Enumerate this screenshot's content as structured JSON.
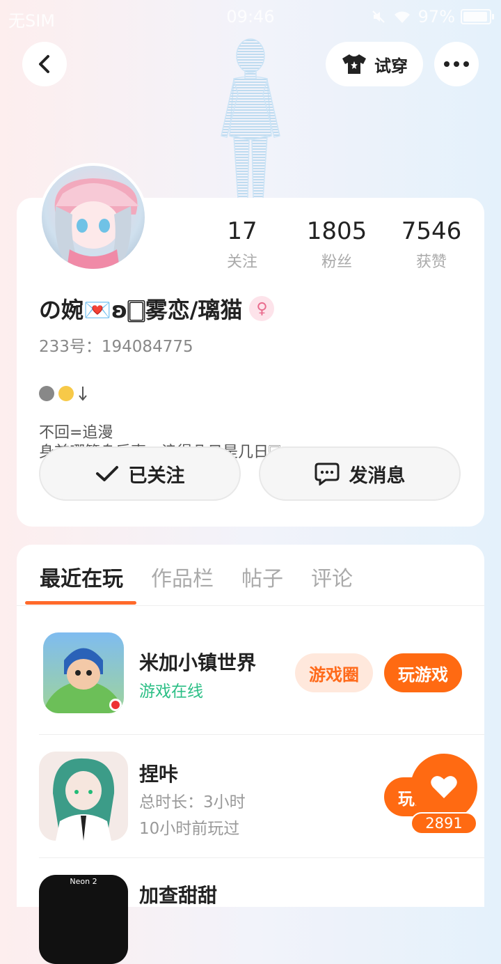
{
  "status_bar": {
    "carrier": "无SIM",
    "time": "09:46",
    "battery": "97%",
    "battery_level": 0.97
  },
  "header": {
    "try_on_label": "试穿"
  },
  "profile": {
    "stats": [
      {
        "value": "17",
        "label": "关注"
      },
      {
        "value": "1805",
        "label": "粉丝"
      },
      {
        "value": "7546",
        "label": "获赞"
      }
    ],
    "name": "の婉💌ʚ🀆雾恋/璃猫",
    "gender_symbol": "♀",
    "id_text": "233号：194084775",
    "bio": "不回=追漫\n身前哪管身后事，浪得几日是几日🀆",
    "following_label": "已关注",
    "message_label": "发消息"
  },
  "tabs": [
    {
      "label": "最近在玩",
      "active": true
    },
    {
      "label": "作品栏",
      "active": false
    },
    {
      "label": "帖子",
      "active": false
    },
    {
      "label": "评论",
      "active": false
    }
  ],
  "games": [
    {
      "title": "米加小镇世界",
      "status": "游戏在线",
      "circle_label": "游戏圈",
      "play_label": "玩游戏"
    },
    {
      "title": "捏咔",
      "duration": "总时长：3小时",
      "last_played": "10小时前玩过",
      "play_label": "玩游戏"
    },
    {
      "title": "加查甜甜",
      "badge_text": "Neon 2"
    }
  ],
  "floating": {
    "favorite_count": "2891"
  }
}
